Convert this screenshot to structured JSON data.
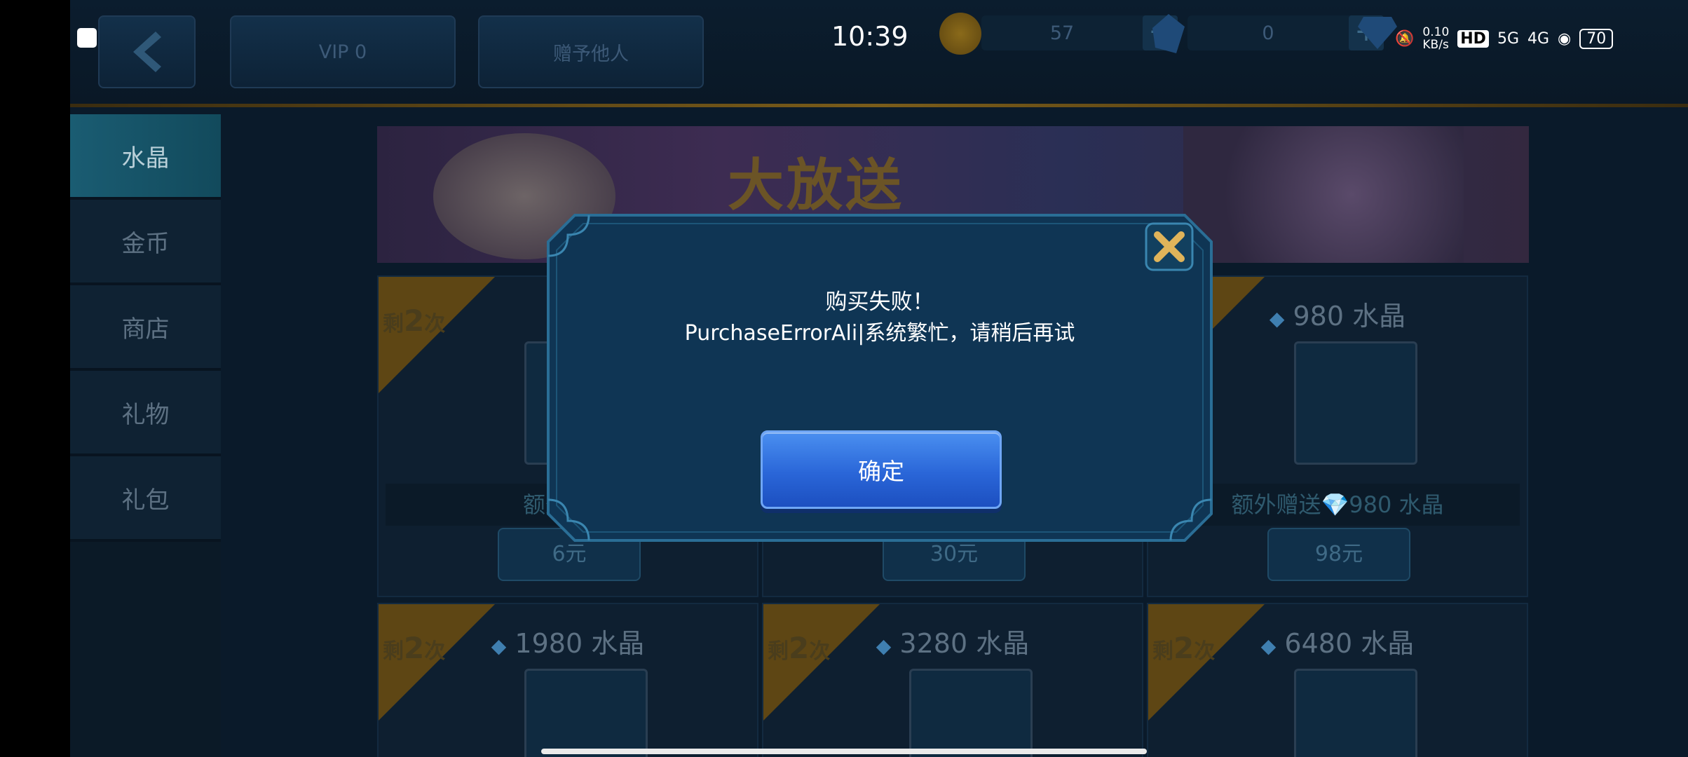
{
  "status_bar": {
    "time": "10:39",
    "net_speed": "0.10",
    "net_speed_unit": "KB/s",
    "hd_label": "HD",
    "sim_5g": "5G",
    "sim_4g": "4G",
    "battery": "70"
  },
  "topbar": {
    "vip_label": "VIP 0",
    "gift_label": "赠予他人",
    "gold_count": "57",
    "crystal_count": "0",
    "plus": "+"
  },
  "sidebar": {
    "items": [
      {
        "label": "水晶",
        "active": true
      },
      {
        "label": "金币",
        "active": false
      },
      {
        "label": "商店",
        "active": false
      },
      {
        "label": "礼物",
        "active": false
      },
      {
        "label": "礼包",
        "active": false
      }
    ]
  },
  "banner": {
    "title": "大放送"
  },
  "cards": [
    {
      "ribbon_prefix": "剩",
      "ribbon_num": "2",
      "ribbon_suffix": "次",
      "title": "",
      "bonus": "额外赠送",
      "price": "6元"
    },
    {
      "ribbon_prefix": "",
      "ribbon_num": "",
      "ribbon_suffix": "",
      "title": "",
      "bonus": "",
      "price": "30元"
    },
    {
      "ribbon_prefix": "",
      "ribbon_num": "",
      "ribbon_suffix": "",
      "title": "980 水晶",
      "bonus": "额外赠送💎980 水晶",
      "price": "98元"
    },
    {
      "ribbon_prefix": "剩",
      "ribbon_num": "2",
      "ribbon_suffix": "次",
      "title": "1980 水晶",
      "bonus": "",
      "price": ""
    },
    {
      "ribbon_prefix": "剩",
      "ribbon_num": "2",
      "ribbon_suffix": "次",
      "title": "3280 水晶",
      "bonus": "",
      "price": ""
    },
    {
      "ribbon_prefix": "剩",
      "ribbon_num": "2",
      "ribbon_suffix": "次",
      "title": "6480 水晶",
      "bonus": "",
      "price": ""
    }
  ],
  "dialog": {
    "title": "购买失败！",
    "message": "PurchaseErrorAli|系统繁忙，请稍后再试",
    "ok_label": "确定"
  },
  "colors": {
    "accent_button": "#2a66d8",
    "dialog_bg": "#0f3554",
    "ribbon_gold": "#b78a22"
  },
  "icons": [
    "back-icon",
    "gold-coin-icon",
    "crystal-icon",
    "close-icon",
    "gem-icon"
  ]
}
